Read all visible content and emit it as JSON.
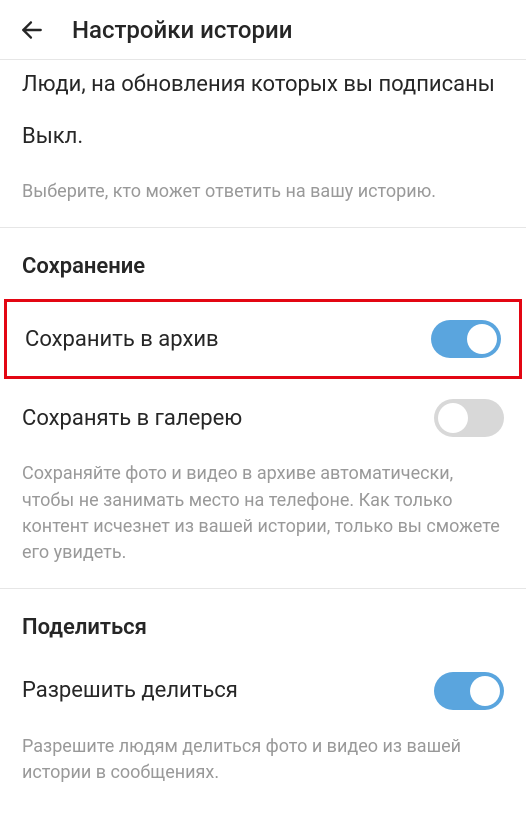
{
  "header": {
    "title": "Настройки истории"
  },
  "reply_section": {
    "option_subscribed": "Люди, на обновления которых вы подписаны",
    "status_off": "Выкл.",
    "helper": "Выберите, кто может ответить на вашу историю."
  },
  "save_section": {
    "title": "Сохранение",
    "archive_label": "Сохранить в архив",
    "gallery_label": "Сохранять в галерею",
    "helper": "Сохраняйте фото и видео в архиве автоматически, чтобы не занимать место на телефоне. Как только контент исчезнет из вашей истории, только вы сможете его увидеть."
  },
  "share_section": {
    "title": "Поделиться",
    "allow_label": "Разрешить делиться",
    "helper": "Разрешите людям делиться фото и видео из вашей истории в сообщениях."
  },
  "toggles": {
    "archive": true,
    "gallery": false,
    "allow_share": true
  }
}
